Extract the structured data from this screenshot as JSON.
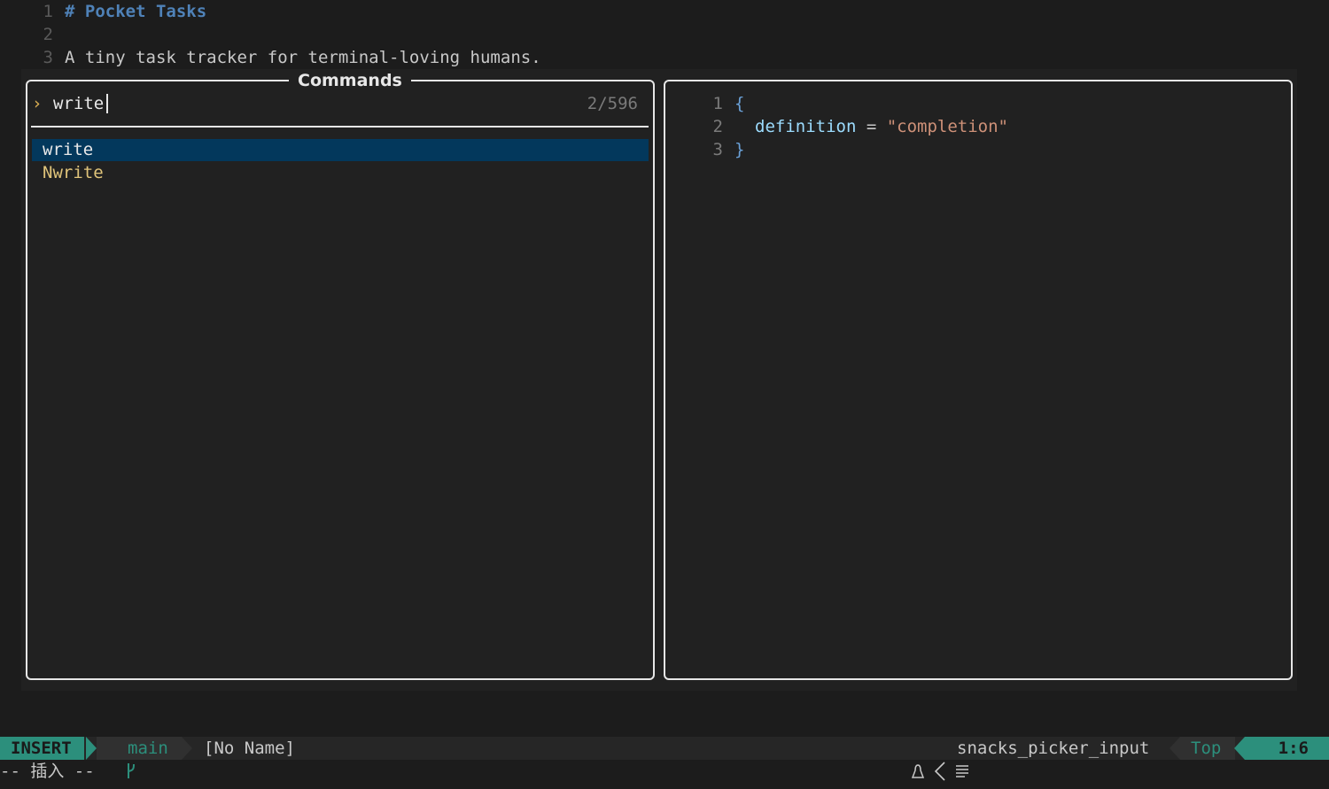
{
  "buffer": {
    "lines": [
      {
        "num": "1",
        "text": "# Pocket Tasks"
      },
      {
        "num": "2",
        "text": ""
      },
      {
        "num": "3",
        "text": "A tiny task tracker for terminal-loving humans."
      }
    ]
  },
  "picker": {
    "title": "Commands",
    "prompt_icon": "chevron-right-icon",
    "prompt_glyph": "›",
    "query": "write",
    "count": "2/596",
    "items": [
      {
        "label": "write",
        "selected": true
      },
      {
        "label": "Nwrite",
        "selected": false
      }
    ]
  },
  "preview": {
    "lines": [
      {
        "num": "1",
        "open": "{"
      },
      {
        "num": "2",
        "key": "definition",
        "op": " = ",
        "value": "\"completion\""
      },
      {
        "num": "3",
        "close": "}"
      }
    ]
  },
  "statusline": {
    "mode": "INSERT",
    "branch_icon": "git-branch-icon",
    "branch": "main",
    "filename": "[No Name]",
    "os_icon": "linux-icon",
    "filetype_icon": "list-icon",
    "filetype": "snacks_picker_input",
    "scroll": "Top",
    "position": "1:6"
  },
  "cmdline": {
    "text": "-- 插入 --"
  },
  "colors": {
    "accent": "#2c8f7c",
    "selection": "#03385c",
    "heading": "#4f82b8",
    "string": "#ce9178",
    "key": "#9cdcfe"
  }
}
